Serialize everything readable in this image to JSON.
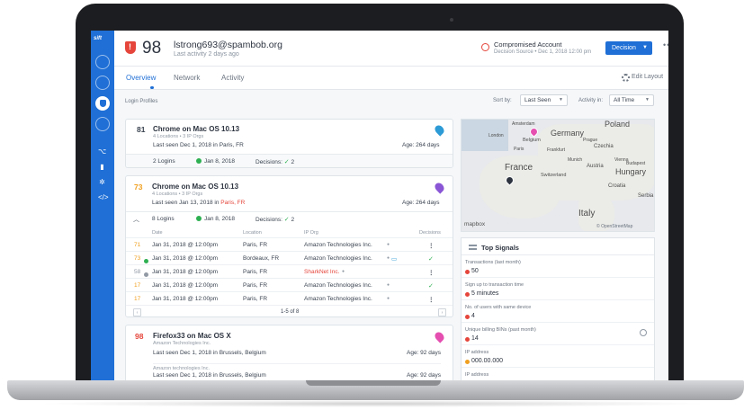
{
  "app": {
    "logo": "sift"
  },
  "header": {
    "score": "98",
    "email": "lstrong693@spambob.org",
    "last_activity": "Last activity 2 days ago",
    "compromised_title": "Compromised Account",
    "compromised_sub": "Decision Source • Dec 1, 2018 12:00 pm",
    "decision_label": "Decision",
    "more": "•••"
  },
  "tabs": [
    "Overview",
    "Network",
    "Activity"
  ],
  "edit_layout": "Edit Layout",
  "login_profiles_label": "Login Profiles",
  "sort": {
    "label": "Sort by:",
    "value": "Last Seen",
    "activity_label": "Activity in:",
    "activity_value": "All Time"
  },
  "cards": [
    {
      "score": "81",
      "score_color": "#e5453b",
      "title": "Chrome on Mac OS 10.13",
      "sub": "4 Locations • 3 IP Orgs",
      "seen_prefix": "Last seen Dec 1, 2018 in ",
      "seen_place": "Paris, FR",
      "age": "Age: 264 days",
      "pin_color": "#2d9bd6",
      "logins": "2 Logins",
      "login_date": "Jan 8, 2018",
      "decisions_label": "Decisions:",
      "decisions_count": "2"
    },
    {
      "score": "73",
      "score_color": "#f0a020",
      "title": "Chrome on Mac OS 10.13",
      "sub": "4 Locations • 3 IP Orgs",
      "seen_prefix": "Last seen Jan 13, 2018 in ",
      "seen_place": "Paris, FR",
      "age": "Age: 264 days",
      "pin_color": "#8a56d6",
      "logins": "8 Logins",
      "login_date": "Jan 8, 2018",
      "decisions_label": "Decisions:",
      "decisions_count": "2"
    },
    {
      "score": "98",
      "score_color": "#e5453b",
      "title": "Firefox33 on Mac OS X",
      "sub": "Amazon Technologies Inc.",
      "seen_prefix": "Last seen Dec 1, 2018 in ",
      "seen_place": "Brussels, Belgium",
      "age": "Age: 92 days",
      "pin_color": "#e54fb0",
      "sub2": "Amazon technologies Inc.",
      "seen2": "Last seen Dec 1, 2018 in Brussels, Belgium",
      "age2": "Age: 92 days"
    }
  ],
  "table": {
    "headers": [
      "Date",
      "Location",
      "IP Org",
      "Decisions"
    ],
    "rows": [
      {
        "score": "71",
        "date": "Jan 31, 2018 @ 12:00pm",
        "location": "Paris, FR",
        "org": "Amazon Technologies Inc.",
        "decision": "more",
        "dot": "",
        "flag": ""
      },
      {
        "score": "73",
        "date": "Jan 31, 2018 @ 12:00pm",
        "location": "Bordeaux, FR",
        "org": "Amazon Technologies Inc.",
        "decision": "check",
        "dot": "#2eb052",
        "flag": "card"
      },
      {
        "score": "58",
        "date": "Jan 31, 2018 @ 12:00pm",
        "location": "Paris, FR",
        "org": "SharkNet Inc.",
        "decision": "more",
        "dot": "#9099a4",
        "flag": ""
      },
      {
        "score": "17",
        "date": "Jan 31, 2018 @ 12:00pm",
        "location": "Paris, FR",
        "org": "Amazon Technologies Inc.",
        "decision": "check",
        "dot": "",
        "flag": ""
      },
      {
        "score": "17",
        "date": "Jan 31, 2018 @ 12:00pm",
        "location": "Paris, FR",
        "org": "Amazon Technologies Inc.",
        "decision": "more",
        "dot": "",
        "flag": ""
      }
    ],
    "pager": "1-5 of 8"
  },
  "map": {
    "labels": [
      "Poland",
      "Germany",
      "Czechia",
      "Belgium",
      "France",
      "Frankfurt",
      "Paris",
      "Hungary",
      "Austria",
      "Switzerland",
      "Italy",
      "Croatia",
      "Serbia",
      "Munich",
      "Vienna",
      "Prague",
      "London",
      "Amsterdam",
      "Budapest"
    ],
    "logo": "mapbox",
    "attribution": "© OpenStreetMap"
  },
  "signals": {
    "title": "Top Signals",
    "items": [
      {
        "label": "Transactions (last month)",
        "value": "50",
        "dot": "#e5453b"
      },
      {
        "label": "Sign up to transaction time",
        "value": "5 minutes",
        "dot": "#e5453b"
      },
      {
        "label": "No. of users with same device",
        "value": "4",
        "dot": "#e5453b"
      },
      {
        "label": "Unique billing BINs (past month)",
        "value": "14",
        "dot": "#e5453b"
      },
      {
        "label": "IP address",
        "value": "000.00.000",
        "dot": "#f0a020"
      },
      {
        "label": "IP address",
        "value": "",
        "dot": ""
      }
    ]
  }
}
